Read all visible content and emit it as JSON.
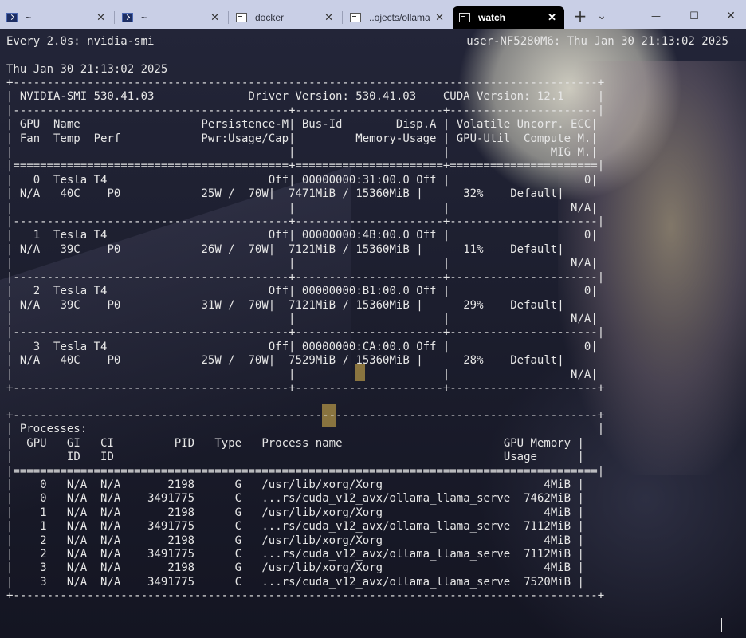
{
  "tabs": [
    {
      "label": "~",
      "icon": "powershell-icon",
      "active": false
    },
    {
      "label": "~",
      "icon": "powershell-icon",
      "active": false
    },
    {
      "label": "docker",
      "icon": "terminal-icon",
      "active": false
    },
    {
      "label": "..ojects/ollama",
      "icon": "terminal-icon",
      "active": false
    },
    {
      "label": "watch",
      "icon": "terminal-icon",
      "active": true
    }
  ],
  "new_tab_label": "+",
  "dropdown_label": "⌄",
  "window_controls": {
    "minimize": "—",
    "maximize": "☐",
    "close": "✕"
  },
  "header": {
    "watch_line": "Every 2.0s: nvidia-smi",
    "host_line": "user-NF5280M6: Thu Jan 30 21:13:02 2025",
    "date_line": "Thu Jan 30 21:13:02 2025"
  },
  "smi": {
    "version_line": "NVIDIA-SMI 530.41.03              Driver Version: 530.41.03    CUDA Version: 12.1",
    "header1": [
      "GPU  Name",
      "Persistence-M",
      "Bus-Id        Disp.A",
      "Volatile Uncorr. ECC"
    ],
    "header2": [
      "Fan  Temp  Perf",
      "Pwr:Usage/Cap",
      "Memory-Usage",
      "GPU-Util  Compute M."
    ],
    "header3": [
      "",
      "",
      "",
      "MIG M."
    ],
    "gpus": [
      {
        "id": "0",
        "name": "Tesla T4",
        "persistence": "Off",
        "bus_id": "00000000:31:00.0",
        "disp": "Off",
        "ecc": "0",
        "fan": "N/A",
        "temp": "40C",
        "perf": "P0",
        "power": "25W /  70W",
        "memory": "7471MiB / 15360MiB",
        "util": "32%",
        "compute": "Default",
        "mig": "N/A"
      },
      {
        "id": "1",
        "name": "Tesla T4",
        "persistence": "Off",
        "bus_id": "00000000:4B:00.0",
        "disp": "Off",
        "ecc": "0",
        "fan": "N/A",
        "temp": "39C",
        "perf": "P0",
        "power": "26W /  70W",
        "memory": "7121MiB / 15360MiB",
        "util": "11%",
        "compute": "Default",
        "mig": "N/A"
      },
      {
        "id": "2",
        "name": "Tesla T4",
        "persistence": "Off",
        "bus_id": "00000000:B1:00.0",
        "disp": "Off",
        "ecc": "0",
        "fan": "N/A",
        "temp": "39C",
        "perf": "P0",
        "power": "31W /  70W",
        "memory": "7121MiB / 15360MiB",
        "util": "29%",
        "compute": "Default",
        "mig": "N/A"
      },
      {
        "id": "3",
        "name": "Tesla T4",
        "persistence": "Off",
        "bus_id": "00000000:CA:00.0",
        "disp": "Off",
        "ecc": "0",
        "fan": "N/A",
        "temp": "40C",
        "perf": "P0",
        "power": "25W /  70W",
        "memory": "7529MiB / 15360MiB",
        "util": "28%",
        "compute": "Default",
        "mig": "N/A"
      }
    ]
  },
  "processes": {
    "title": "Processes:",
    "header1": [
      "GPU",
      "GI",
      "CI",
      "PID",
      "Type",
      "Process name",
      "GPU Memory"
    ],
    "header2": [
      "",
      "ID",
      "ID",
      "",
      "",
      "",
      "Usage"
    ],
    "rows": [
      {
        "gpu": "0",
        "gi": "N/A",
        "ci": "N/A",
        "pid": "2198",
        "type": "G",
        "name": "/usr/lib/xorg/Xorg",
        "mem": "4MiB"
      },
      {
        "gpu": "0",
        "gi": "N/A",
        "ci": "N/A",
        "pid": "3491775",
        "type": "C",
        "name": "...rs/cuda_v12_avx/ollama_llama_server",
        "mem": "7462MiB"
      },
      {
        "gpu": "1",
        "gi": "N/A",
        "ci": "N/A",
        "pid": "2198",
        "type": "G",
        "name": "/usr/lib/xorg/Xorg",
        "mem": "4MiB"
      },
      {
        "gpu": "1",
        "gi": "N/A",
        "ci": "N/A",
        "pid": "3491775",
        "type": "C",
        "name": "...rs/cuda_v12_avx/ollama_llama_server",
        "mem": "7112MiB"
      },
      {
        "gpu": "2",
        "gi": "N/A",
        "ci": "N/A",
        "pid": "2198",
        "type": "G",
        "name": "/usr/lib/xorg/Xorg",
        "mem": "4MiB"
      },
      {
        "gpu": "2",
        "gi": "N/A",
        "ci": "N/A",
        "pid": "3491775",
        "type": "C",
        "name": "...rs/cuda_v12_avx/ollama_llama_server",
        "mem": "7112MiB"
      },
      {
        "gpu": "3",
        "gi": "N/A",
        "ci": "N/A",
        "pid": "2198",
        "type": "G",
        "name": "/usr/lib/xorg/Xorg",
        "mem": "4MiB"
      },
      {
        "gpu": "3",
        "gi": "N/A",
        "ci": "N/A",
        "pid": "3491775",
        "type": "C",
        "name": "...rs/cuda_v12_avx/ollama_llama_server",
        "mem": "7520MiB"
      }
    ]
  }
}
